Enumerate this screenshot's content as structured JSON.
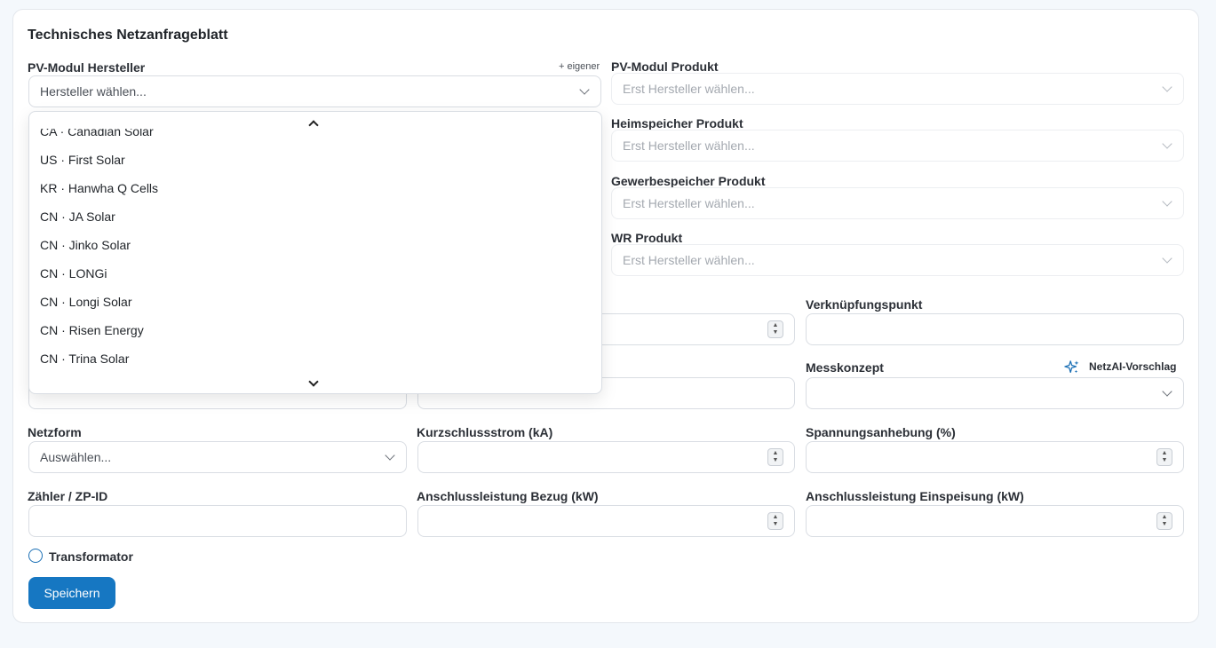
{
  "title": "Technisches Netzanfrageblatt",
  "pv_hersteller": {
    "label": "PV-Modul Hersteller",
    "add_own": "+ eigener",
    "placeholder": "Hersteller wählen...",
    "dropdown_items": [
      "CA · Canadian Solar",
      "US · First Solar",
      "KR · Hanwha Q Cells",
      "CN · JA Solar",
      "CN · Jinko Solar",
      "CN · LONGi",
      "CN · Longi Solar",
      "CN · Risen Energy",
      "CN · Trina Solar"
    ]
  },
  "pv_produkt": {
    "label": "PV-Modul Produkt",
    "placeholder": "Erst Hersteller wählen..."
  },
  "heimspeicher": {
    "label": "Heimspeicher Produkt",
    "placeholder": "Erst Hersteller wählen..."
  },
  "gewerbespeicher": {
    "label": "Gewerbespeicher Produkt",
    "placeholder": "Erst Hersteller wählen..."
  },
  "wr_produkt": {
    "label": "WR Produkt",
    "placeholder": "Erst Hersteller wählen..."
  },
  "verknuepfungspunkt": {
    "label": "Verknüpfungspunkt",
    "value": ""
  },
  "messkonzept": {
    "label": "Messkonzept",
    "ai_suggest": "NetzAI-Vorschlag",
    "value": ""
  },
  "netzform": {
    "label": "Netzform",
    "placeholder": "Auswählen..."
  },
  "kurzschlussstrom": {
    "label": "Kurzschlussstrom (kA)",
    "value": ""
  },
  "spannungsanhebung": {
    "label": "Spannungsanhebung (%)",
    "value": ""
  },
  "zaehler": {
    "label": "Zähler / ZP-ID",
    "value": ""
  },
  "anschluss_bezug": {
    "label": "Anschlussleistung Bezug (kW)",
    "value": ""
  },
  "anschluss_einspeisung": {
    "label": "Anschlussleistung Einspeisung (kW)",
    "value": ""
  },
  "transformator": {
    "label": "Transformator",
    "checked": false
  },
  "save_label": "Speichern",
  "colors": {
    "primary": "#1677c2",
    "ai_icon": "#1a6fb5"
  }
}
